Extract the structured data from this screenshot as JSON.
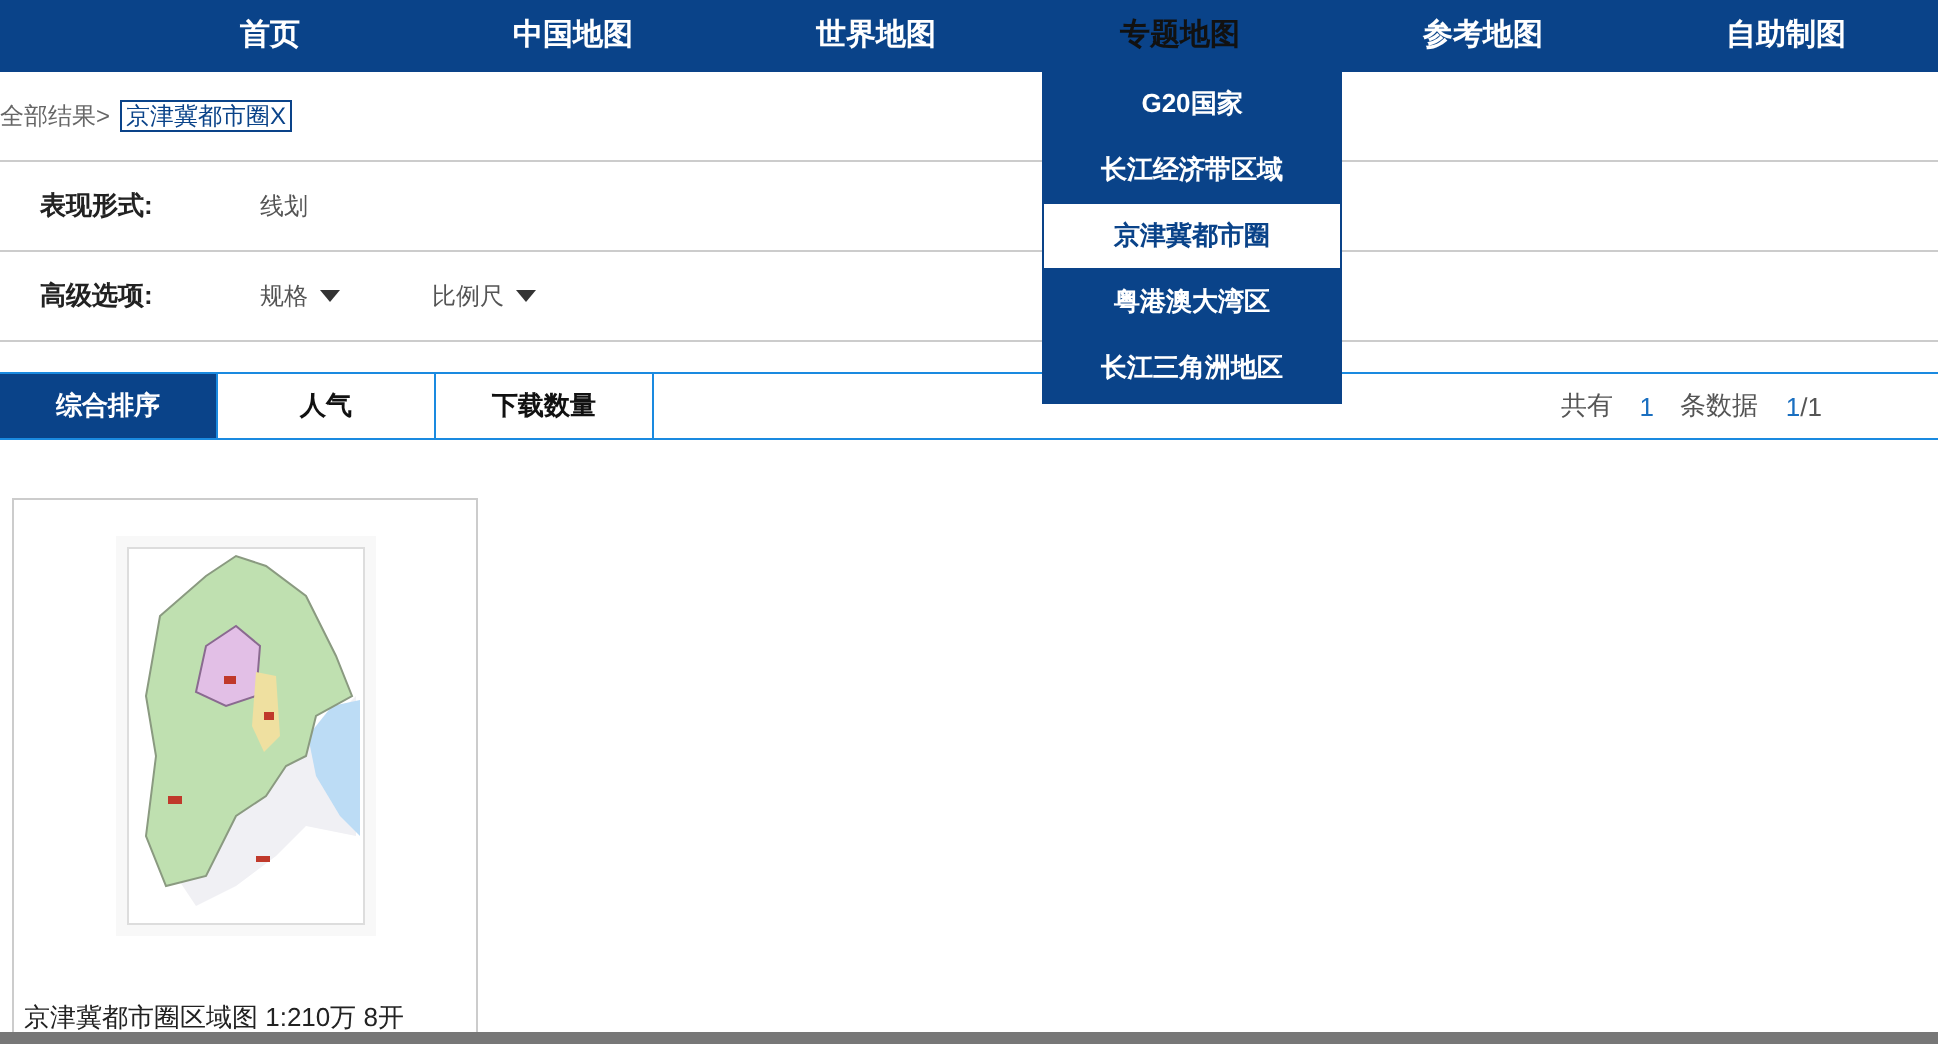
{
  "nav": [
    {
      "label": "首页",
      "selected": false
    },
    {
      "label": "中国地图",
      "selected": false
    },
    {
      "label": "世界地图",
      "selected": false
    },
    {
      "label": "专题地图",
      "selected": true,
      "menu": [
        {
          "label": "G20国家",
          "selected": false
        },
        {
          "label": "长江经济带区域",
          "selected": false
        },
        {
          "label": "京津冀都市圈",
          "selected": true
        },
        {
          "label": "粤港澳大湾区",
          "selected": false
        },
        {
          "label": "长江三角洲地区",
          "selected": false
        }
      ]
    },
    {
      "label": "参考地图",
      "selected": false
    },
    {
      "label": "自助制图",
      "selected": false
    }
  ],
  "breadcrumb": {
    "root": "全部结果>",
    "tag": "京津冀都市圈X"
  },
  "filters": [
    {
      "label": "表现形式:",
      "options": [
        {
          "label": "线划",
          "kind": "plain"
        }
      ]
    },
    {
      "label": "高级选项:",
      "options": [
        {
          "label": "规格",
          "kind": "dropdown"
        },
        {
          "label": "比例尺",
          "kind": "dropdown"
        }
      ]
    }
  ],
  "sort_tabs": [
    {
      "label": "综合排序",
      "selected": true
    },
    {
      "label": "人气",
      "selected": false
    },
    {
      "label": "下载数量",
      "selected": false
    }
  ],
  "pager": {
    "total_label": "共有",
    "total": "1",
    "unit": "条数据",
    "page": "1",
    "pages": "/1"
  },
  "results": [
    {
      "kind": "picture",
      "caption": "京津冀都市圈区域图 1:210万 8开"
    }
  ]
}
